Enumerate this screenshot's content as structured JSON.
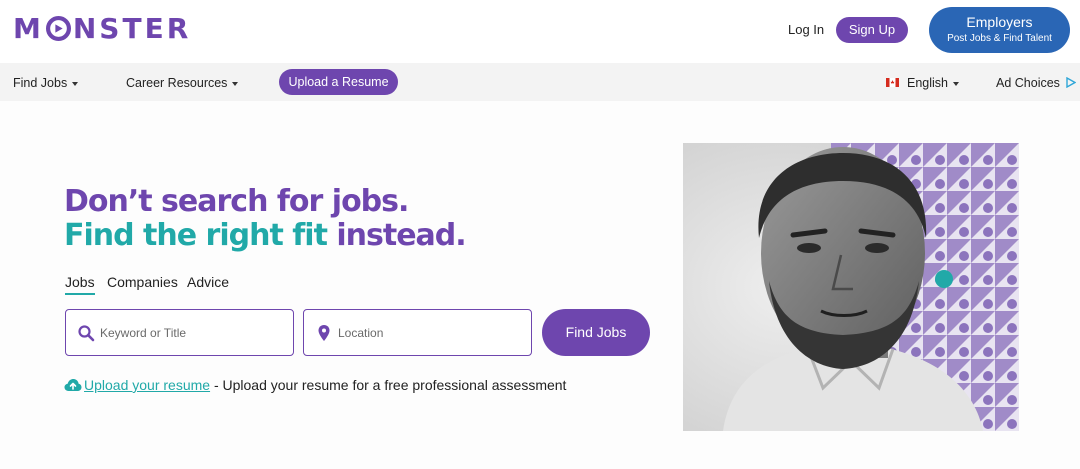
{
  "brand": {
    "logo_text": "MONSTER",
    "logo_before": "M",
    "logo_after": "NSTER",
    "brand_purple": "#6e46ae",
    "accent_teal": "#21a9a8",
    "employer_blue": "#2a66b5"
  },
  "header": {
    "login_label": "Log In",
    "signup_label": "Sign Up",
    "employers_title": "Employers",
    "employers_subtitle": "Post Jobs & Find Talent"
  },
  "nav": {
    "find_jobs": "Find Jobs",
    "career_resources": "Career Resources",
    "upload_resume": "Upload a Resume",
    "language": "English",
    "ad_choices": "Ad Choices",
    "flag_icon": "canada-flag-icon",
    "ad_choices_icon": "ad-choices-icon"
  },
  "hero": {
    "headline_line1": "Don’t search for jobs.",
    "headline_line2_highlight": "Find the right fit",
    "headline_line2_rest": "instead."
  },
  "tabs": [
    {
      "label": "Jobs",
      "active": true
    },
    {
      "label": "Companies",
      "active": false
    },
    {
      "label": "Advice",
      "active": false
    }
  ],
  "search": {
    "keyword_placeholder": "Keyword or Title",
    "keyword_value": "",
    "location_placeholder": "Location",
    "location_value": "",
    "find_button": "Find Jobs",
    "keyword_icon": "search-icon",
    "location_icon": "location-pin-icon"
  },
  "upload": {
    "link_text": "Upload your resume",
    "description": " - Upload your resume for a free professional assessment",
    "icon": "cloud-upload-icon"
  },
  "photo": {
    "subject": "man-portrait",
    "has_teal_dot": true
  }
}
